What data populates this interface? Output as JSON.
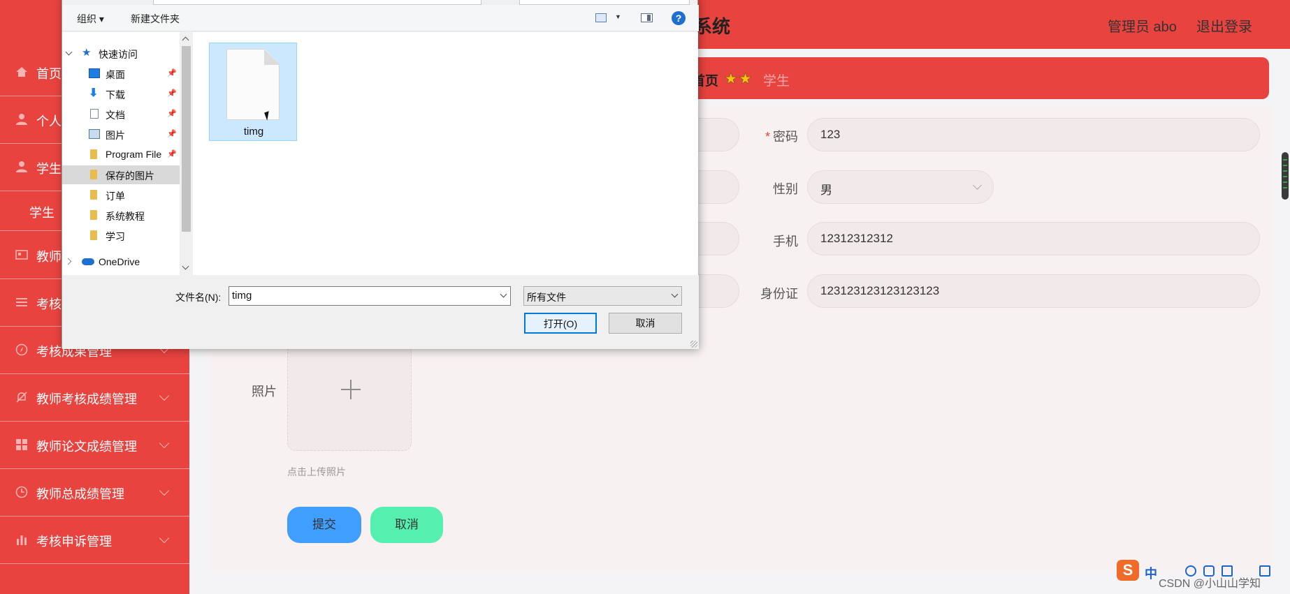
{
  "header": {
    "system_title_visible": "系统",
    "admin_label": "管理员 abo",
    "logout_label": "退出登录"
  },
  "sidebar": {
    "items": [
      {
        "label": "首页",
        "icon": "home-icon"
      },
      {
        "label": "个人",
        "icon": "user-icon"
      },
      {
        "label": "学生",
        "icon": "user-icon"
      },
      {
        "label": "教师",
        "icon": "id-card-icon"
      },
      {
        "label": "考核",
        "icon": "list-icon"
      },
      {
        "label": "考核成果管理",
        "icon": "compass-icon"
      },
      {
        "label": "教师考核成绩管理",
        "icon": "bell-icon"
      },
      {
        "label": "教师论文成绩管理",
        "icon": "grid-icon"
      },
      {
        "label": "教师总成绩管理",
        "icon": "clock-icon"
      },
      {
        "label": "考核申诉管理",
        "icon": "bar-chart-icon"
      }
    ],
    "sub_item": "学生"
  },
  "breadcrumb": {
    "home": "首页",
    "current": "学生"
  },
  "form": {
    "password_label": "密码",
    "password_value": "123",
    "gender_label": "性别",
    "gender_value": "男",
    "phone_label": "手机",
    "phone_value": "12312312312",
    "id_label": "身份证",
    "id_value": "123123123123123123",
    "photo_label": "照片",
    "upload_hint": "点击上传照片",
    "submit_label": "提交",
    "cancel_label": "取消"
  },
  "dialog": {
    "toolbar": {
      "organize": "组织 ▾",
      "new_folder": "新建文件夹",
      "help": "?"
    },
    "tree": [
      {
        "label": "快速访问",
        "icon": "star-icon"
      },
      {
        "label": "桌面",
        "icon": "desktop-icon"
      },
      {
        "label": "下载",
        "icon": "download-icon"
      },
      {
        "label": "文档",
        "icon": "document-icon"
      },
      {
        "label": "图片",
        "icon": "picture-icon"
      },
      {
        "label": "Program File",
        "icon": "folder-icon"
      },
      {
        "label": "保存的图片",
        "icon": "folder-icon"
      },
      {
        "label": "订单",
        "icon": "folder-icon"
      },
      {
        "label": "系统教程",
        "icon": "folder-icon"
      },
      {
        "label": "学习",
        "icon": "folder-icon"
      },
      {
        "label": "OneDrive",
        "icon": "cloud-icon"
      }
    ],
    "file_name": "timg",
    "filename_label": "文件名(N):",
    "filename_value": "timg",
    "filetype_value": "所有文件",
    "open_label": "打开(O)",
    "cancel_label": "取消"
  },
  "ime": {
    "brand": "S",
    "mode": "中"
  },
  "watermark": "CSDN @小山山学知"
}
